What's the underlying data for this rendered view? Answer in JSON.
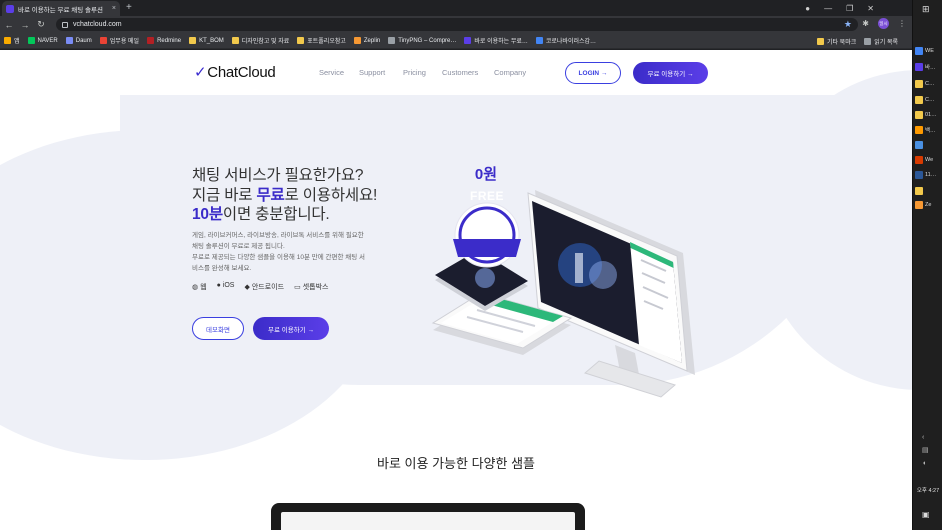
{
  "browser": {
    "tab_title": "바로 이용하는 무료 채팅 솔루션",
    "tab_close": "×",
    "new_tab": "+",
    "url": "vchatcloud.com",
    "profile_label": "일시",
    "bookmarks": [
      {
        "label": "앱",
        "color": "#f9ab00"
      },
      {
        "label": "NAVER",
        "color": "#03c75a"
      },
      {
        "label": "Daum",
        "color": "#7a8cf5"
      },
      {
        "label": "업무용 메일",
        "color": "#ea4335"
      },
      {
        "label": "Redmine",
        "color": "#b32024"
      },
      {
        "label": "KT_BOM",
        "color": "#f2c94c"
      },
      {
        "label": "디자인참고 및 자료",
        "color": "#f2c94c"
      },
      {
        "label": "포트폴리오참고",
        "color": "#f2c94c"
      },
      {
        "label": "Zeplin",
        "color": "#f69833"
      },
      {
        "label": "TinyPNG – Compre…",
        "color": "#9aa0a6"
      },
      {
        "label": "바로 이용하는 무료…",
        "color": "#5b3ee8"
      },
      {
        "label": "코로나바이러스감…",
        "color": "#4285f4"
      }
    ],
    "bookmarks_right": [
      {
        "label": "기타 북마크",
        "color": "#f2c94c"
      },
      {
        "label": "읽기 목록",
        "color": "#9aa0a6"
      }
    ]
  },
  "taskbar": {
    "items": [
      {
        "label": "WE",
        "color": "#4285f4"
      },
      {
        "label": "바…",
        "color": "#5b3ee8"
      },
      {
        "label": "C…",
        "color": "#f2c94c"
      },
      {
        "label": "C…",
        "color": "#f2c94c"
      },
      {
        "label": "01…",
        "color": "#f2c94c"
      },
      {
        "label": "백…",
        "color": "#ff9a00"
      },
      {
        "label": "",
        "color": "#4a90e2"
      },
      {
        "label": "We",
        "color": "#d83b01"
      },
      {
        "label": "11…",
        "color": "#2b5797"
      },
      {
        "label": "",
        "color": "#f2c94c"
      },
      {
        "label": "Ze",
        "color": "#f69833"
      }
    ],
    "time": "오후 4:27"
  },
  "site": {
    "logo": "ChatCloud",
    "nav": [
      "Service",
      "Support",
      "Pricing",
      "Customers",
      "Company"
    ],
    "login": "LOGIN →",
    "free_button": "무료 이용하기 →",
    "hero": {
      "line1": "채팅 서비스가 필요한가요?",
      "line2_pre": "지금 바로 ",
      "line2_bold": "무료",
      "line2_post": "로 이용하세요!",
      "line3_bold": "10분",
      "line3_post": "이면 충분합니다.",
      "desc": [
        "게임, 라이브커머스, 라이브방송, 라이브톡 서비스를 위해 필요한",
        "채팅 솔루션이 무료로 제공 됩니다.",
        "무료로 제공되는 다양한 샘플을 이용해 10분 만에 간편한 채팅 서",
        "비스를 완성해 보세요."
      ],
      "platforms": [
        "웹",
        "iOS",
        "안드로이드",
        "셋톱박스"
      ],
      "demo_button": "데모화면",
      "free_button": "무료 이용하기 →"
    },
    "badge": {
      "price": "0원",
      "label": "FREE"
    },
    "section_title": "바로 이용 가능한 다양한 샘플"
  }
}
